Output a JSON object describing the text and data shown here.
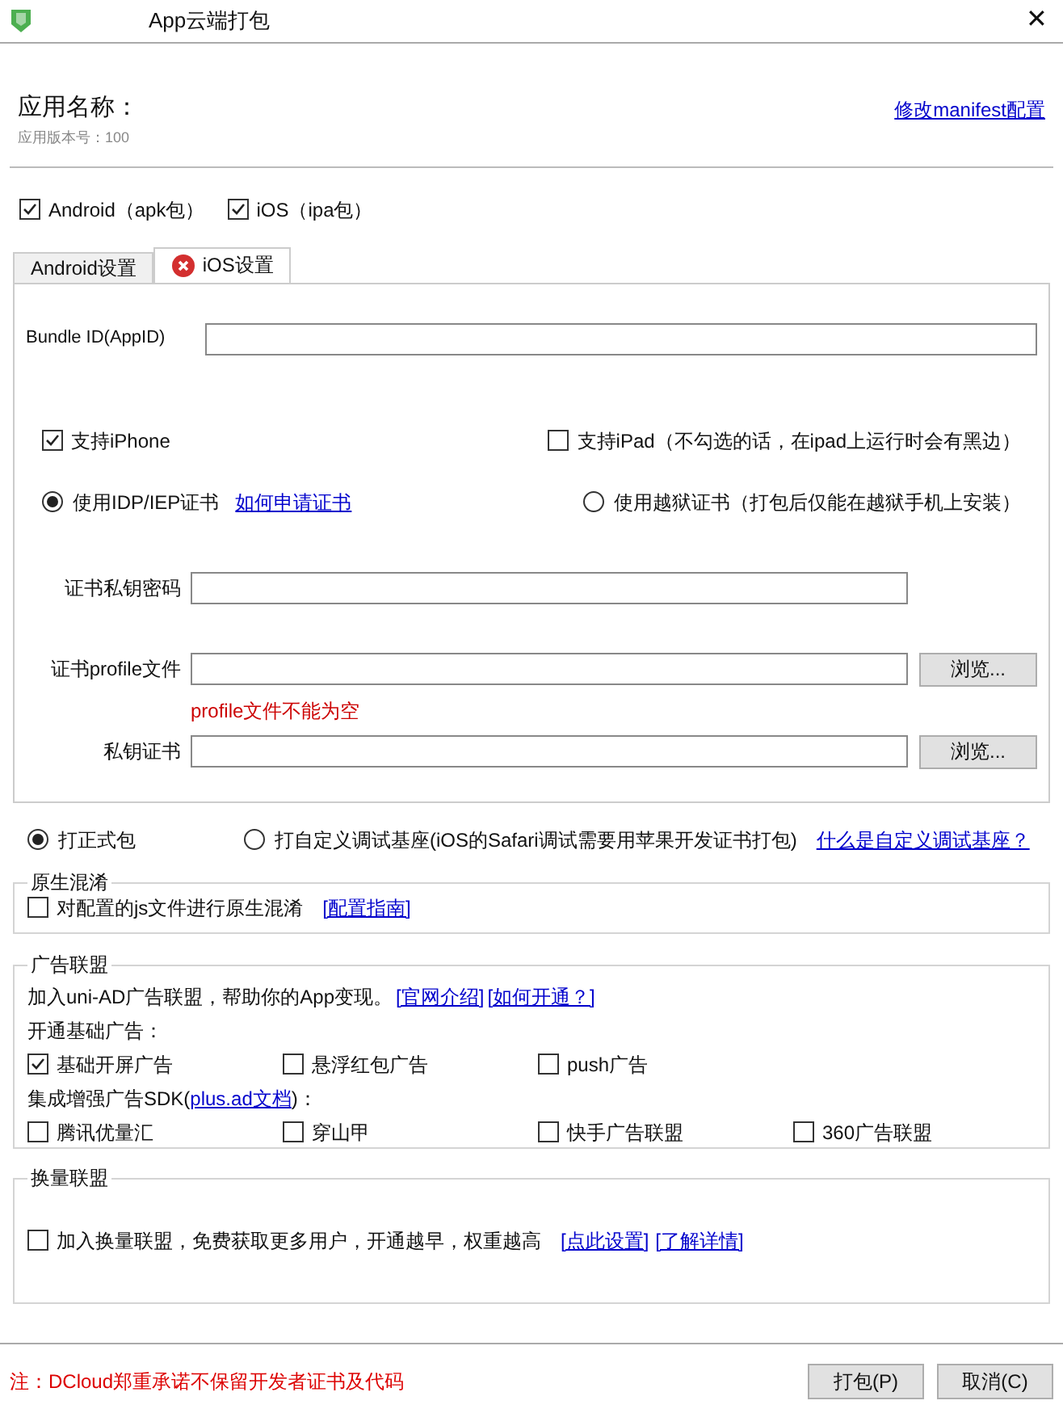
{
  "window": {
    "title": "App云端打包",
    "close": "✕"
  },
  "app": {
    "name_label": "应用名称：",
    "version": "应用版本号：100",
    "manifest_link": "修改manifest配置"
  },
  "platforms": [
    {
      "label": "Android（apk包）",
      "checked": true
    },
    {
      "label": "iOS（ipa包）",
      "checked": true
    }
  ],
  "tabs": [
    {
      "label": "Android设置",
      "selected": false,
      "error": false
    },
    {
      "label": "iOS设置",
      "selected": true,
      "error": true
    }
  ],
  "ios": {
    "bundle_label": "Bundle ID(AppID)",
    "devices": [
      {
        "label": "支持iPhone",
        "checked": true
      },
      {
        "label": "支持iPad（不勾选的话，在ipad上运行时会有黑边）",
        "checked": false
      }
    ],
    "certs": [
      {
        "label": "使用IDP/IEP证书",
        "selected": true,
        "link": "如何申请证书"
      },
      {
        "label": "使用越狱证书（打包后仅能在越狱手机上安装）",
        "selected": false
      }
    ],
    "fields": [
      {
        "label": "证书私钥密码"
      },
      {
        "label": "证书profile文件",
        "button": "浏览...",
        "error": "profile文件不能为空"
      },
      {
        "label": "私钥证书",
        "button": "浏览..."
      }
    ]
  },
  "package_types": [
    {
      "label": "打正式包",
      "selected": true
    },
    {
      "label": "打自定义调试基座(iOS的Safari调试需要用苹果开发证书打包)",
      "selected": false
    }
  ],
  "package_link": "什么是自定义调试基座？",
  "obfuscation": {
    "title": "原生混淆",
    "option": {
      "label": "对配置的js文件进行原生混淆",
      "checked": false
    },
    "links": [
      "[配置指南]"
    ]
  },
  "ads": {
    "title": "广告联盟",
    "intro": "加入uni-AD广告联盟，帮助你的App变现。",
    "links": [
      "[官网介绍]",
      "[如何开通？]"
    ],
    "basic_label": "开通基础广告：",
    "basic": [
      {
        "label": "基础开屏广告",
        "checked": true
      },
      {
        "label": "悬浮红包广告",
        "checked": false
      },
      {
        "label": "push广告",
        "checked": false
      }
    ],
    "sdk_prefix": "集成增强广告SDK(",
    "sdk_link": "plus.ad文档",
    "sdk_suffix": ")：",
    "sdk": [
      {
        "label": "腾讯优量汇",
        "checked": false
      },
      {
        "label": "穿山甲",
        "checked": false
      },
      {
        "label": "快手广告联盟",
        "checked": false
      },
      {
        "label": "360广告联盟",
        "checked": false
      }
    ]
  },
  "exchange": {
    "title": "换量联盟",
    "option": {
      "label": "加入换量联盟，免费获取更多用户，开通越早，权重越高",
      "checked": false
    },
    "links": [
      "[点此设置]",
      "[了解详情]"
    ]
  },
  "footer": {
    "note": "注：DCloud郑重承诺不保留开发者证书及代码",
    "buttons": [
      "打包(P)",
      "取消(C)"
    ]
  }
}
